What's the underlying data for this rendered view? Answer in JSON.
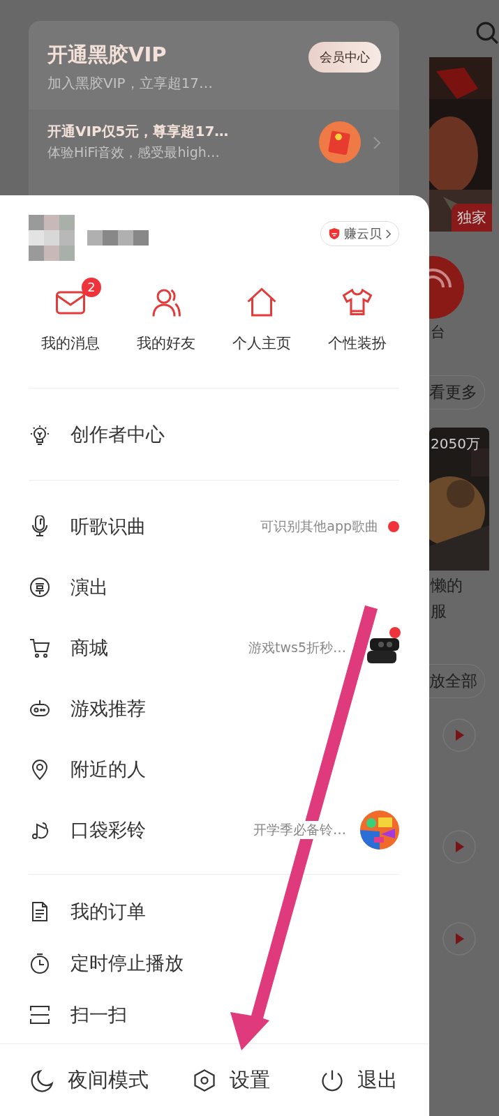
{
  "vip_card": {
    "title": "开通黑胶VIP",
    "subtitle": "加入黑胶VIP，立享超17…",
    "button": "会员中心",
    "promo_title": "开通VIP仅5元，尊享超17…",
    "promo_subtitle": "体验HiFi音效，感受最high…"
  },
  "user": {
    "coins_button": "赚云贝"
  },
  "shortcuts": [
    {
      "label": "我的消息",
      "badge": "2"
    },
    {
      "label": "我的好友"
    },
    {
      "label": "个人主页"
    },
    {
      "label": "个性装扮"
    }
  ],
  "menu_groups": [
    [
      {
        "label": "创作者中心",
        "dot": false
      }
    ],
    [
      {
        "label": "听歌识曲",
        "detail": "可识别其他app歌曲",
        "dot": true
      },
      {
        "label": "演出",
        "dot": false
      },
      {
        "label": "商城",
        "detail": "游戏tws5折秒…",
        "dot": true
      },
      {
        "label": "游戏推荐",
        "dot": false
      },
      {
        "label": "附近的人",
        "dot": false
      },
      {
        "label": "口袋彩铃",
        "detail": "开学季必备铃…",
        "dot": false
      }
    ],
    [
      {
        "label": "我的订单",
        "dot": false
      },
      {
        "label": "定时停止播放",
        "dot": false
      },
      {
        "label": "扫一扫",
        "dot": false
      }
    ]
  ],
  "bottom_bar": [
    {
      "label": "夜间模式"
    },
    {
      "label": "设置"
    },
    {
      "label": "退出"
    }
  ],
  "background": {
    "tag": "独家",
    "radio_label": "台",
    "more_button": "看更多",
    "play_count": "2050万",
    "caption_lines": [
      "懒的",
      "服"
    ],
    "play_all_button": "放全部"
  }
}
